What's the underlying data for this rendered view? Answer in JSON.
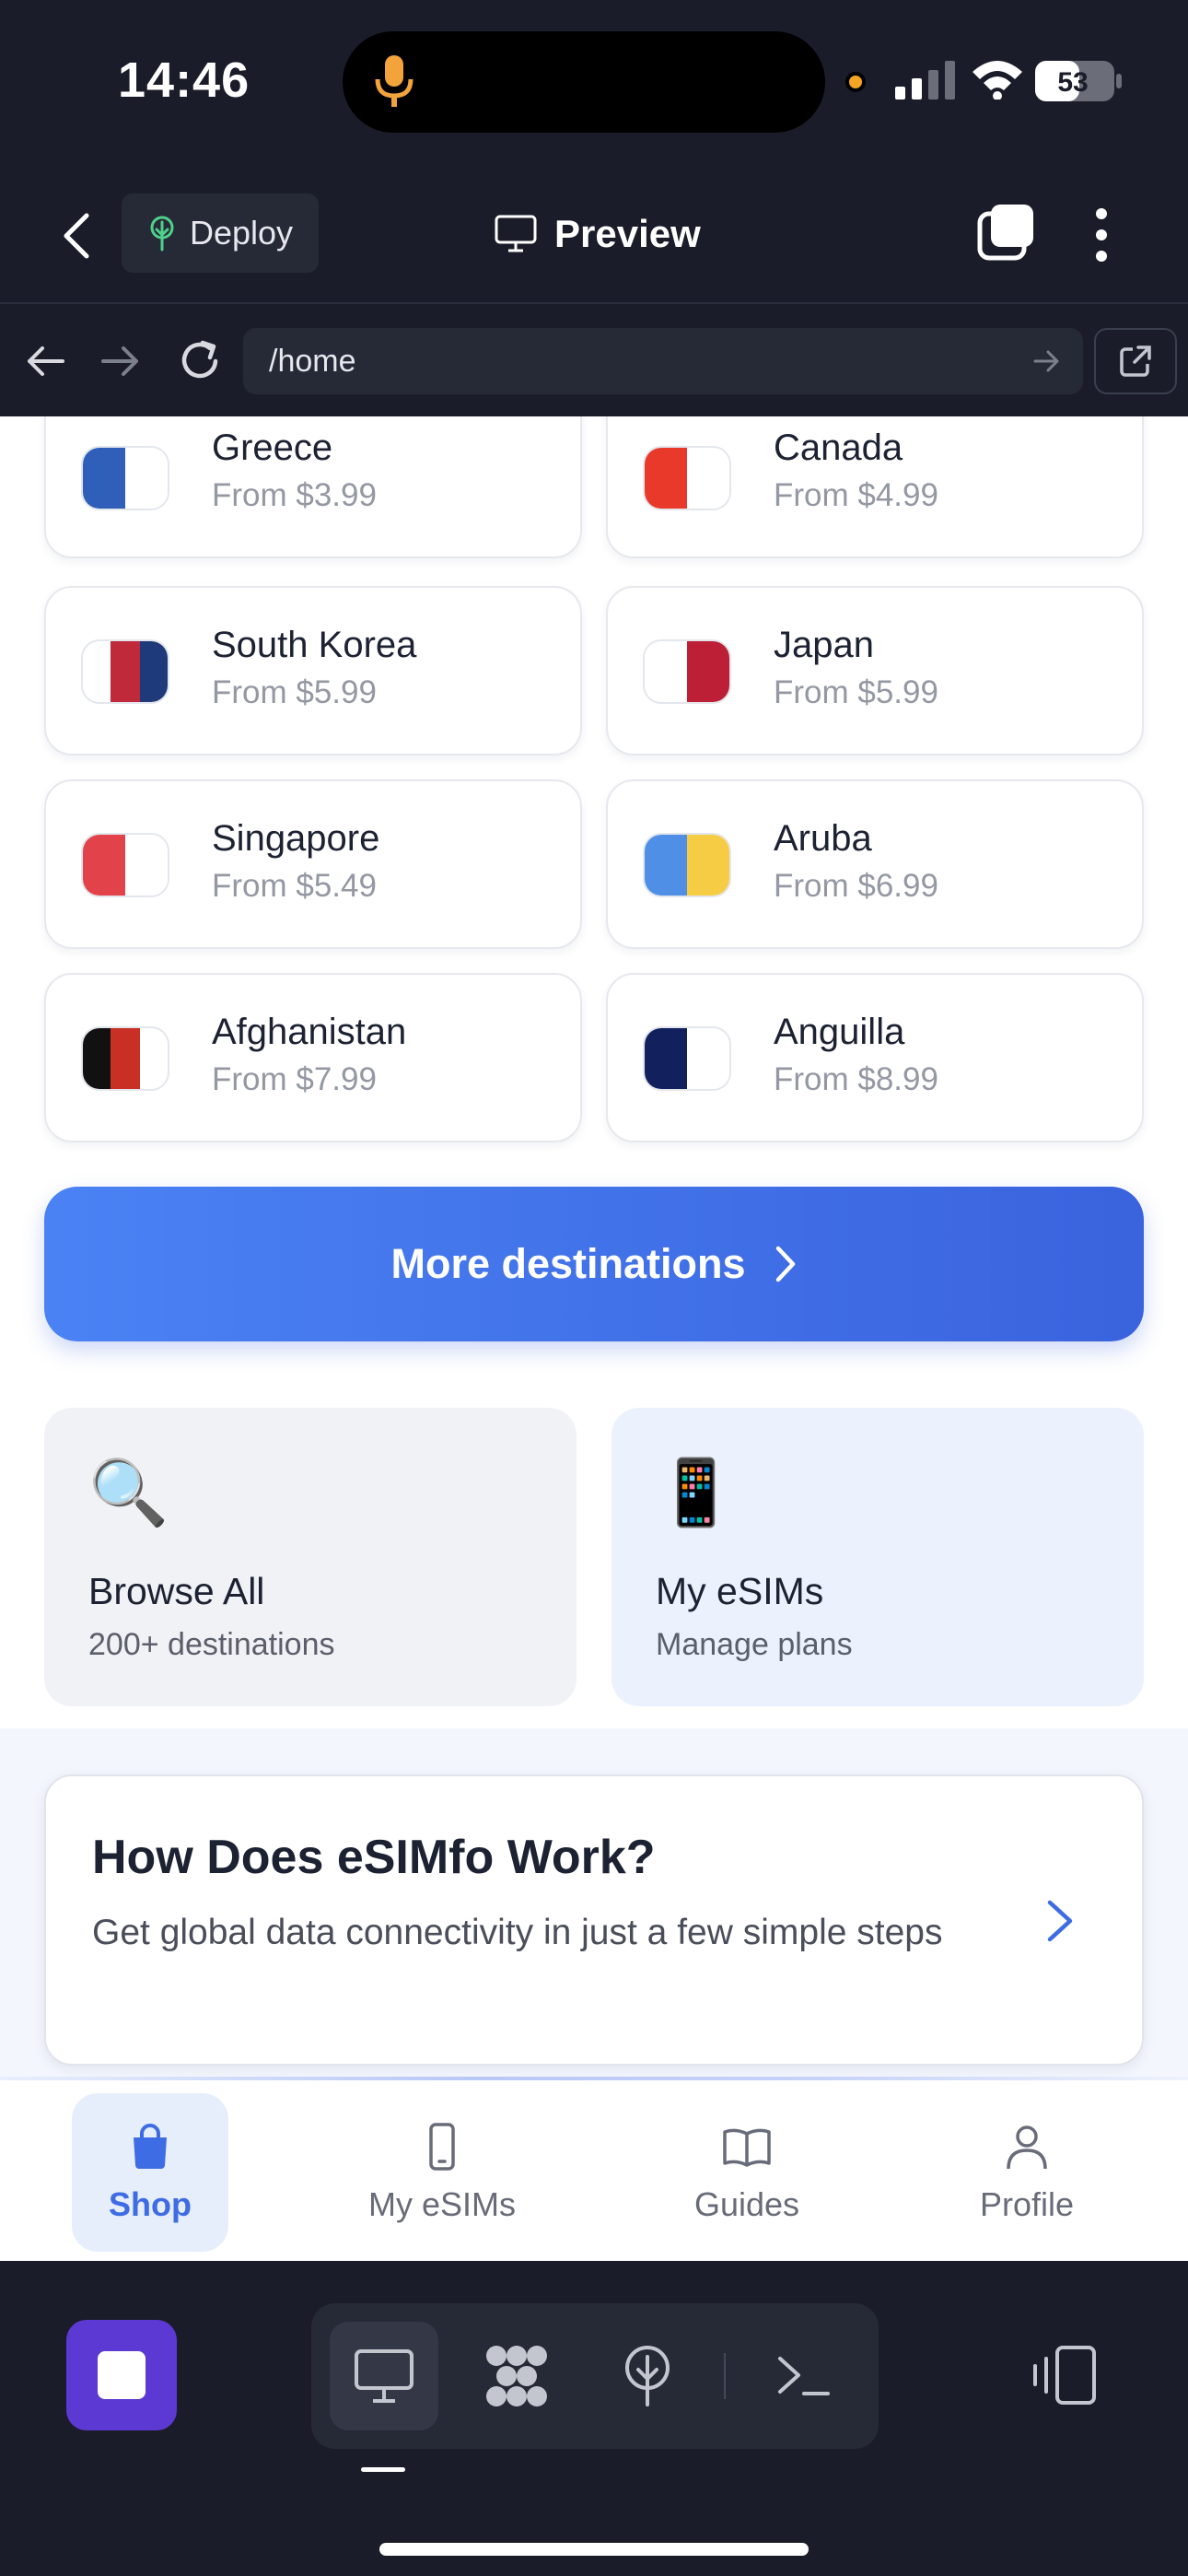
{
  "status_bar": {
    "time": "14:46",
    "battery": "53"
  },
  "top_bar": {
    "deploy_label": "Deploy",
    "preview_label": "Preview"
  },
  "url_bar": {
    "url": "/home"
  },
  "destinations": [
    {
      "name": "Greece",
      "price": "From $3.99",
      "flag": [
        "#2f5fb8",
        "#ffffff"
      ]
    },
    {
      "name": "Canada",
      "price": "From $4.99",
      "flag": [
        "#e8392a",
        "#ffffff"
      ]
    },
    {
      "name": "South Korea",
      "price": "From $5.99",
      "flag": [
        "#ffffff",
        "#c0293a",
        "#1e3a7a"
      ]
    },
    {
      "name": "Japan",
      "price": "From $5.99",
      "flag": [
        "#ffffff",
        "#bc1f36"
      ]
    },
    {
      "name": "Singapore",
      "price": "From $5.49",
      "flag": [
        "#e2424a",
        "#ffffff"
      ]
    },
    {
      "name": "Aruba",
      "price": "From $6.99",
      "flag": [
        "#4f8fe6",
        "#f7cc45"
      ]
    },
    {
      "name": "Afghanistan",
      "price": "From $7.99",
      "flag": [
        "#111111",
        "#c92f25",
        "#ffffff"
      ]
    },
    {
      "name": "Anguilla",
      "price": "From $8.99",
      "flag": [
        "#12205e",
        "#ffffff"
      ]
    }
  ],
  "more_destinations_label": "More destinations",
  "tiles": [
    {
      "icon": "🔍",
      "title": "Browse All",
      "subtitle": "200+ destinations"
    },
    {
      "icon": "📱",
      "title": "My eSIMs",
      "subtitle": "Manage plans"
    }
  ],
  "how_it_works": {
    "title": "How Does eSIMfo Work?",
    "description": "Get global data connectivity in just a few simple steps"
  },
  "bottom_nav": [
    {
      "label": "Shop",
      "icon": "shopping-bag-icon",
      "active": true
    },
    {
      "label": "My eSIMs",
      "icon": "phone-icon",
      "active": false
    },
    {
      "label": "Guides",
      "icon": "book-icon",
      "active": false
    },
    {
      "label": "Profile",
      "icon": "user-icon",
      "active": false
    }
  ],
  "colors": {
    "accent": "#3e6ce4",
    "stop_button": "#5d39d4",
    "chrome": "#1a1d29"
  }
}
